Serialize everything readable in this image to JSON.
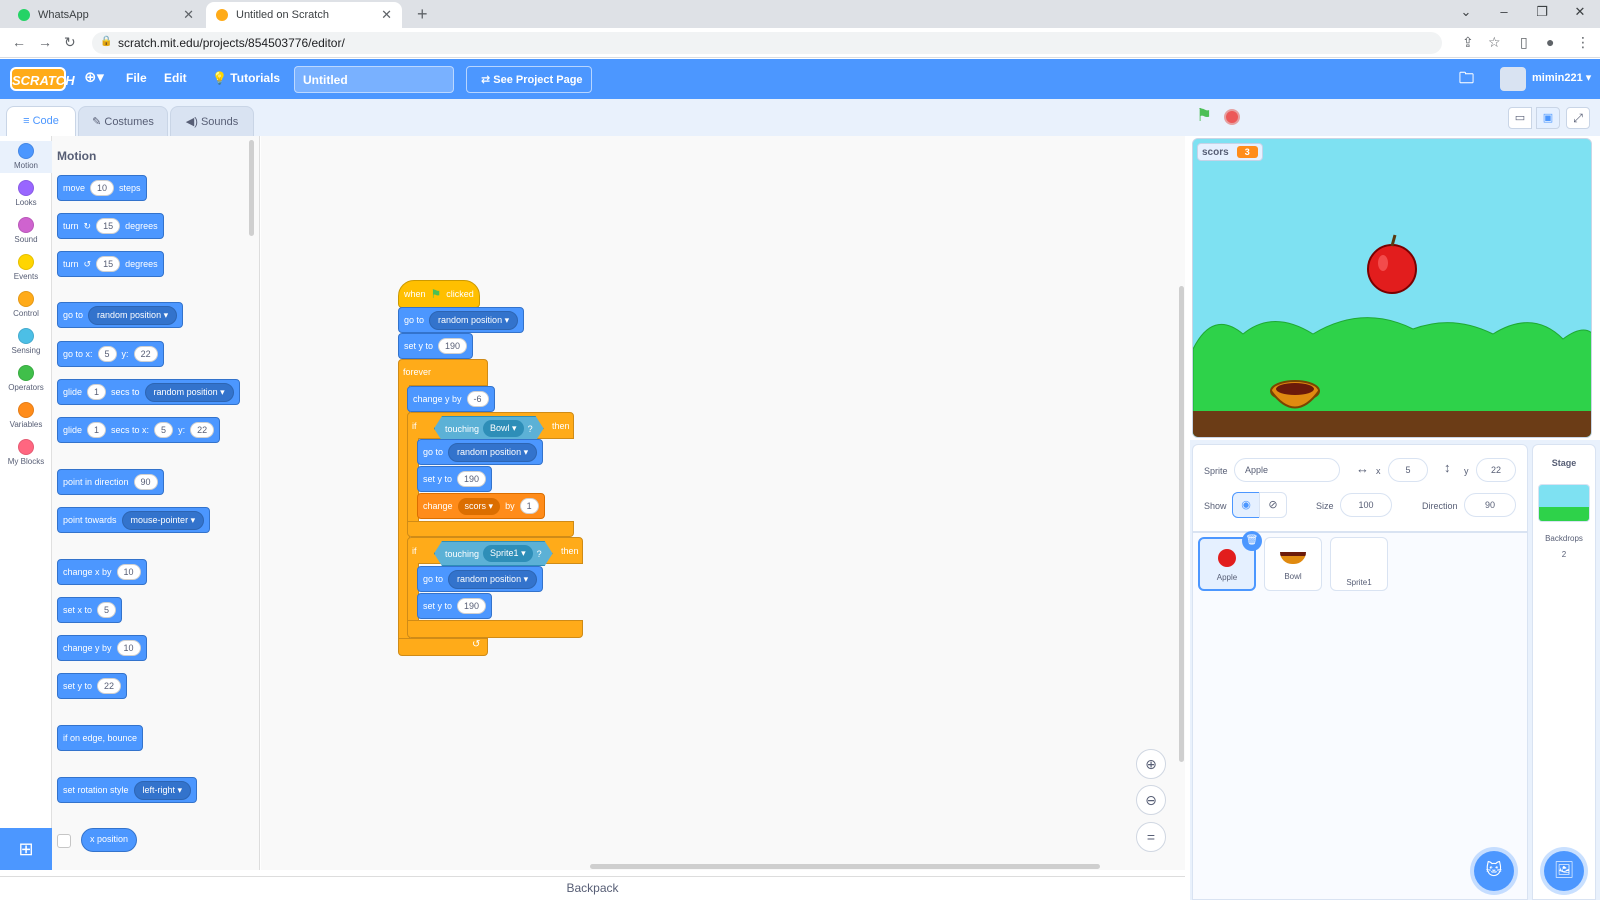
{
  "browser": {
    "tabs": [
      {
        "title": "WhatsApp",
        "favicon_color": "#25d366"
      },
      {
        "title": "Untitled on Scratch",
        "favicon_color": "#ffab19"
      }
    ],
    "url": "scratch.mit.edu/projects/854503776/editor/"
  },
  "menubar": {
    "logo": "SCRATCH",
    "file": "File",
    "edit": "Edit",
    "tutorials": "Tutorials",
    "project_title": "Untitled",
    "see_project": "See Project Page",
    "username": "mimin221"
  },
  "editor_tabs": {
    "code": "Code",
    "costumes": "Costumes",
    "sounds": "Sounds"
  },
  "categories": [
    {
      "label": "Motion",
      "color": "#4c97ff"
    },
    {
      "label": "Looks",
      "color": "#9966ff"
    },
    {
      "label": "Sound",
      "color": "#cf63cf"
    },
    {
      "label": "Events",
      "color": "#ffd500"
    },
    {
      "label": "Control",
      "color": "#ffab19"
    },
    {
      "label": "Sensing",
      "color": "#4cbfe6"
    },
    {
      "label": "Operators",
      "color": "#40bf4a"
    },
    {
      "label": "Variables",
      "color": "#ff8c1a"
    },
    {
      "label": "My Blocks",
      "color": "#ff6680"
    }
  ],
  "palette": {
    "heading": "Motion",
    "move": "move",
    "move_val": "10",
    "steps": "steps",
    "turn": "turn",
    "turn_val": "15",
    "degrees": "degrees",
    "goto": "go to",
    "random_position": "random position",
    "goto_xy": "go to x:",
    "x_val": "5",
    "y_label": "y:",
    "y_val": "22",
    "glide": "glide",
    "glide_val": "1",
    "secs_to": "secs to",
    "secs_to_x": "secs to x:",
    "point_dir": "point in direction",
    "dir_val": "90",
    "point_towards": "point towards",
    "mouse_pointer": "mouse-pointer",
    "change_x": "change x by",
    "change_x_val": "10",
    "set_x": "set x to",
    "set_x_val": "5",
    "change_y": "change y by",
    "change_y_val": "10",
    "set_y": "set y to",
    "set_y_val": "22",
    "edge_bounce": "if on edge, bounce",
    "rotation_style": "set rotation style",
    "left_right": "left-right",
    "x_position": "x position"
  },
  "script": {
    "when": "when",
    "clicked": "clicked",
    "goto": "go to",
    "random_position": "random position",
    "set_y": "set y to",
    "set_y_val": "190",
    "forever": "forever",
    "change_y": "change y by",
    "change_y_val": "-6",
    "if": "if",
    "touching": "touching",
    "bowl": "Bowl",
    "q": "?",
    "then": "then",
    "change": "change",
    "scors": "scors",
    "by": "by",
    "change_val": "1",
    "sprite1": "Sprite1"
  },
  "backpack": "Backpack",
  "stage": {
    "monitor_label": "scors",
    "monitor_value": "3"
  },
  "sprite_info": {
    "sprite_label": "Sprite",
    "sprite_name": "Apple",
    "x_label": "x",
    "x_val": "5",
    "y_label": "y",
    "y_val": "22",
    "show_label": "Show",
    "size_label": "Size",
    "size_val": "100",
    "direction_label": "Direction",
    "direction_val": "90"
  },
  "sprites": [
    {
      "name": "Apple"
    },
    {
      "name": "Bowl"
    },
    {
      "name": "Sprite1"
    }
  ],
  "stage_panel": {
    "title": "Stage",
    "backdrops_label": "Backdrops",
    "backdrops_count": "2"
  }
}
